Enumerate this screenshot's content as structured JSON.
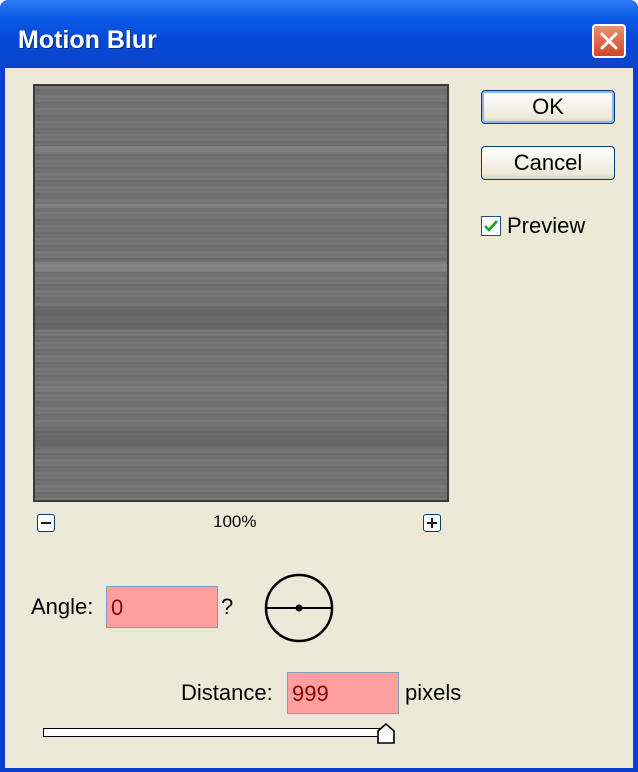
{
  "window": {
    "title": "Motion Blur"
  },
  "buttons": {
    "ok_label": "OK",
    "cancel_label": "Cancel"
  },
  "preview": {
    "label": "Preview",
    "checked": true
  },
  "zoom": {
    "level": "100%"
  },
  "angle": {
    "label": "Angle:",
    "value": "0",
    "unit": "?"
  },
  "distance": {
    "label": "Distance:",
    "value": "999",
    "unit": "pixels",
    "slider_fraction": 1.0
  },
  "colors": {
    "titlebar": "#0a5ae6",
    "client": "#ece9d8",
    "field_bg": "#ff9f9f",
    "field_text": "#8b0000"
  },
  "icons": {
    "close": "close-icon",
    "zoom_out": "minus-icon",
    "zoom_in": "plus-icon",
    "check": "checkmark-icon"
  }
}
